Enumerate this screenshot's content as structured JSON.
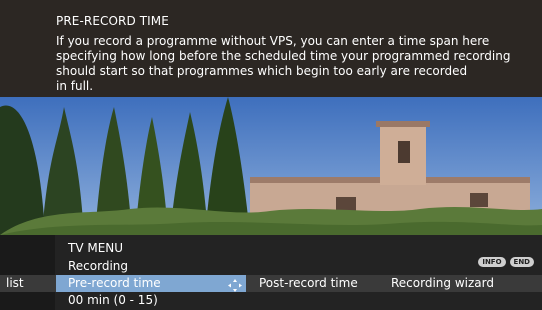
{
  "info": {
    "title": "PRE-RECORD TIME",
    "body": "If you record a programme without VPS, you can enter a time span here\nspecifying how long before the scheduled time your programmed recording\nshould start so that programmes which begin too early are recorded\nin full."
  },
  "menu": {
    "title": "TV MENU",
    "subtitle": "Recording",
    "badges": {
      "info": "INFO",
      "end": "END"
    },
    "tabs": {
      "list": "list",
      "pre_record": "Pre-record time",
      "post_record": "Post-record time",
      "wizard": "Recording wizard"
    },
    "value": "00 min (0 - 15)"
  },
  "icons": {
    "selector": "four-way-arrow-icon"
  },
  "colors": {
    "header_bg": "#2c2723",
    "menu_bg": "#232323",
    "selected_tab": "#7fa7d2"
  }
}
